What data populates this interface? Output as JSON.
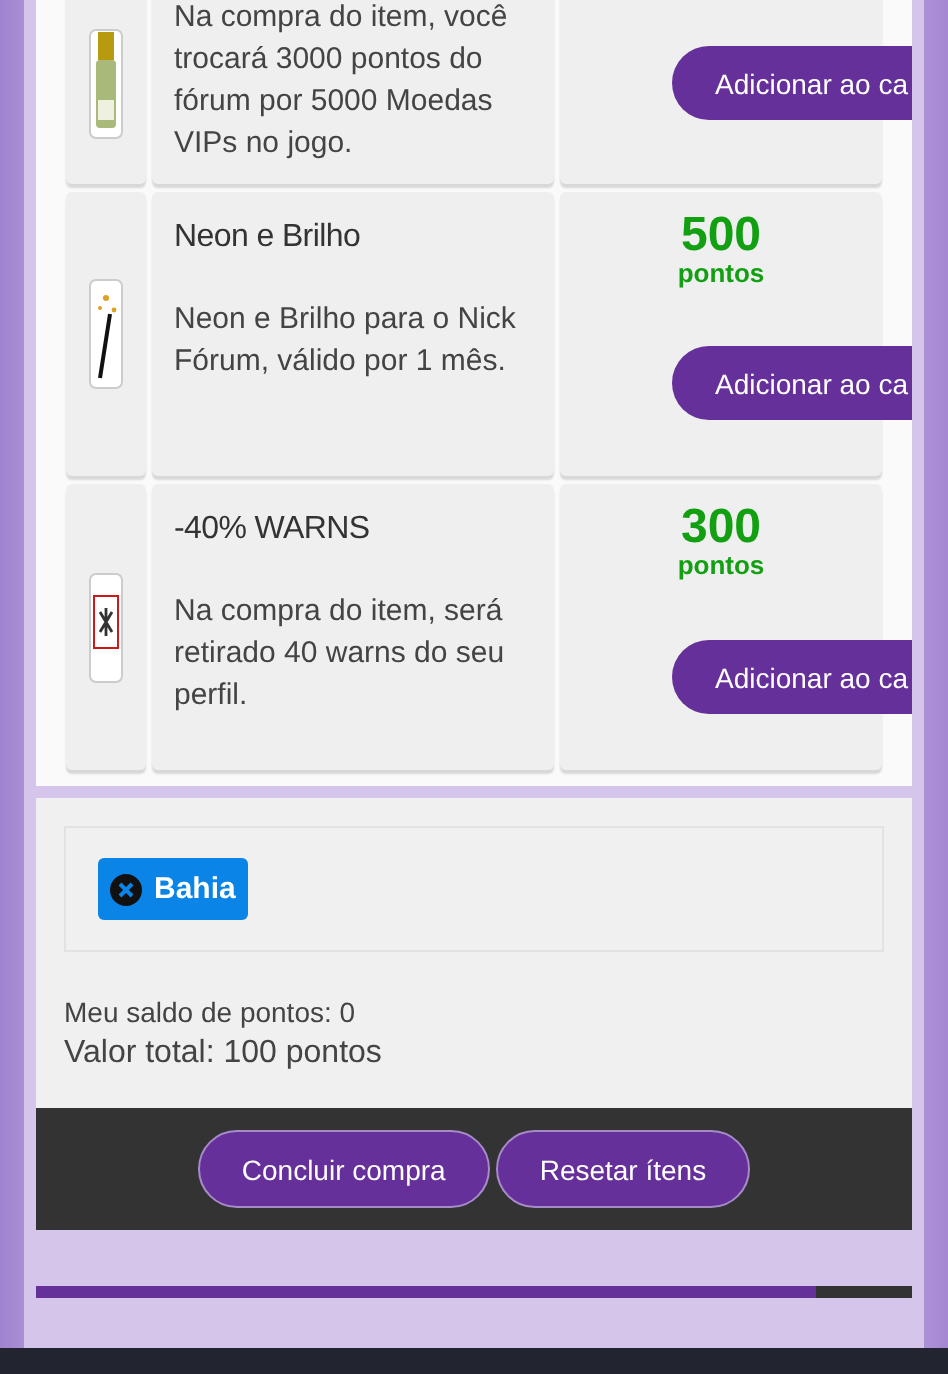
{
  "items": [
    {
      "description": "Na compra do item, você trocará 3000 pontos do fórum por 5000 Moedas VIPs no jogo.",
      "button": "Adicionar ao ca"
    },
    {
      "name": "Neon e Brilho",
      "price": "500",
      "price_unit": "pontos",
      "description": "Neon e Brilho para o Nick Fórum, válido por 1 mês.",
      "button": "Adicionar ao ca"
    },
    {
      "name": "-40% WARNS",
      "price": "300",
      "price_unit": "pontos",
      "description": "Na compra do item, será retirado 40 warns do seu perfil.",
      "button": "Adicionar ao ca"
    }
  ],
  "cart": {
    "tags": [
      {
        "label": "Bahia"
      }
    ],
    "balance": "Meu saldo de pontos: 0",
    "total": "Valor total: 100 pontos"
  },
  "actions": [
    "Concluir compra",
    "Resetar ítens"
  ],
  "progress": {
    "level": 0.89
  }
}
